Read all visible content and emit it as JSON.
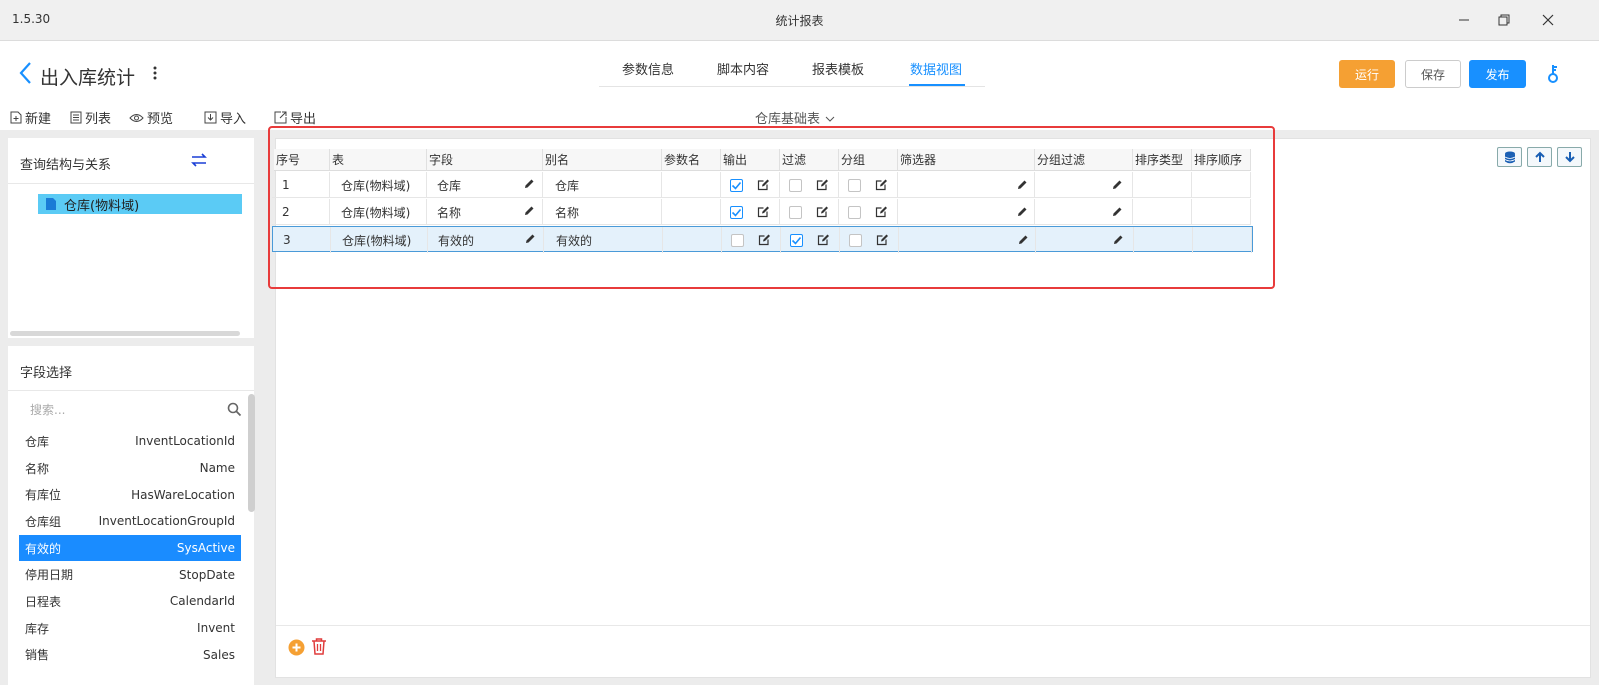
{
  "window": {
    "version": "1.5.30",
    "title": "统计报表"
  },
  "header": {
    "title": "出入库统计",
    "tabs": [
      {
        "label": "参数信息",
        "active": false
      },
      {
        "label": "脚本内容",
        "active": false
      },
      {
        "label": "报表模板",
        "active": false
      },
      {
        "label": "数据视图",
        "active": true
      }
    ],
    "buttons": {
      "run": "运行",
      "save": "保存",
      "publish": "发布"
    },
    "colors": {
      "run": "#f5a033",
      "publish": "#1890ff",
      "accent": "#1890ff"
    }
  },
  "toolbar": {
    "new": "新建",
    "list": "列表",
    "preview": "预览",
    "import": "导入",
    "export": "导出",
    "center_label": "仓库基础表"
  },
  "query_panel": {
    "title": "查询结构与关系",
    "node": "仓库(物料域)"
  },
  "field_panel": {
    "title": "字段选择",
    "search_placeholder": "搜索...",
    "fields": [
      {
        "label": "仓库",
        "code": "InventLocationId",
        "selected": false
      },
      {
        "label": "名称",
        "code": "Name",
        "selected": false
      },
      {
        "label": "有库位",
        "code": "HasWareLocation",
        "selected": false
      },
      {
        "label": "仓库组",
        "code": "InventLocationGroupId",
        "selected": false
      },
      {
        "label": "有效的",
        "code": "SysActive",
        "selected": true
      },
      {
        "label": "停用日期",
        "code": "StopDate",
        "selected": false
      },
      {
        "label": "日程表",
        "code": "CalendarId",
        "selected": false
      },
      {
        "label": "库存",
        "code": "Invent",
        "selected": false
      },
      {
        "label": "销售",
        "code": "Sales",
        "selected": false
      }
    ]
  },
  "grid": {
    "columns": [
      "序号",
      "表",
      "字段",
      "别名",
      "参数名",
      "输出",
      "过滤",
      "分组",
      "筛选器",
      "分组过滤",
      "排序类型",
      "排序顺序"
    ],
    "rows": [
      {
        "no": "1",
        "table": "仓库(物料域)",
        "field": "仓库",
        "alias": "仓库",
        "param": "",
        "output": true,
        "filter": false,
        "group": false,
        "selected": false
      },
      {
        "no": "2",
        "table": "仓库(物料域)",
        "field": "名称",
        "alias": "名称",
        "param": "",
        "output": true,
        "filter": false,
        "group": false,
        "selected": false
      },
      {
        "no": "3",
        "table": "仓库(物料域)",
        "field": "有效的",
        "alias": "有效的",
        "param": "",
        "output": false,
        "filter": true,
        "group": false,
        "selected": true
      }
    ]
  }
}
